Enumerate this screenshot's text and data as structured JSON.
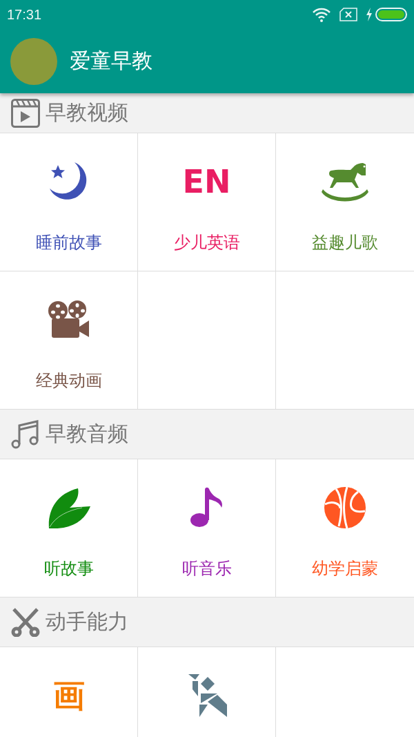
{
  "status_bar": {
    "time": "17:31"
  },
  "app_bar": {
    "title": "爱童早教"
  },
  "sections": [
    {
      "kind": "video",
      "title": "早教视频",
      "items": [
        {
          "kind": "moon",
          "label": "睡前故事",
          "color": "#3f51b5"
        },
        {
          "kind": "en",
          "glyph": "EN",
          "label": "少儿英语",
          "color": "#e91e63"
        },
        {
          "kind": "horse",
          "label": "益趣儿歌",
          "color": "#558b2f"
        },
        {
          "kind": "camera",
          "label": "经典动画",
          "color": "#795548"
        }
      ]
    },
    {
      "kind": "music",
      "title": "早教音频",
      "items": [
        {
          "kind": "leaf",
          "label": "听故事",
          "color": "#118c0f"
        },
        {
          "kind": "note",
          "label": "听音乐",
          "color": "#9c27b0"
        },
        {
          "kind": "ball",
          "label": "幼学启蒙",
          "color": "#ff5722"
        }
      ]
    },
    {
      "kind": "scissors",
      "title": "动手能力",
      "items": [
        {
          "kind": "hua",
          "glyph": "画",
          "color": "#f57c00"
        },
        {
          "kind": "tangram",
          "color": "#607d8b"
        }
      ]
    }
  ]
}
